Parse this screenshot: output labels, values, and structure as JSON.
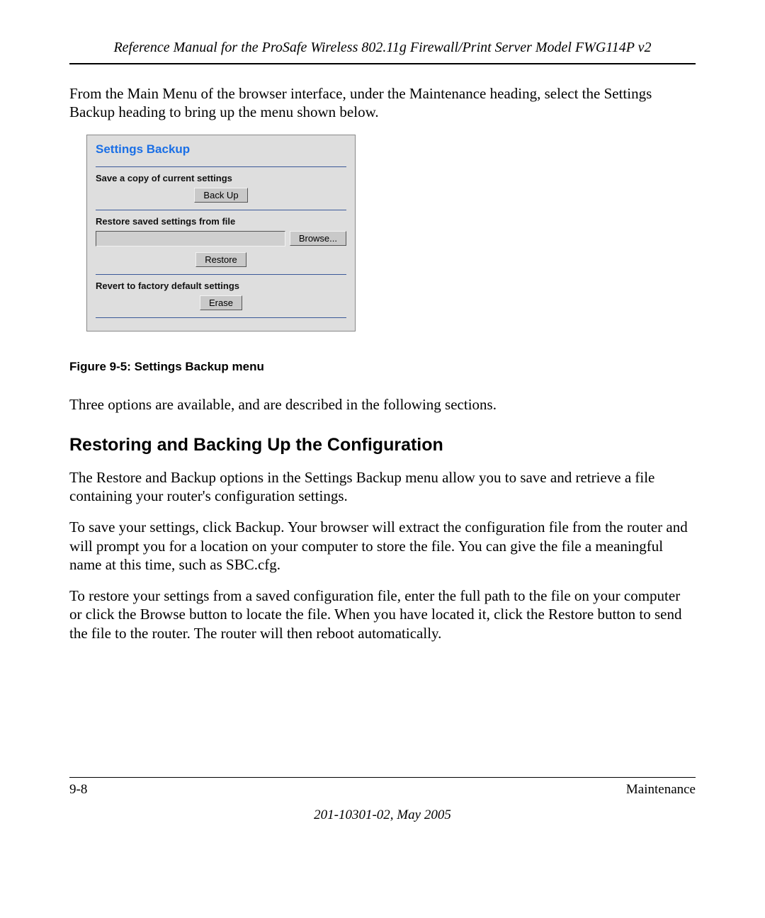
{
  "header": {
    "title": "Reference Manual for the ProSafe Wireless 802.11g  Firewall/Print Server Model FWG114P v2"
  },
  "intro_para": "From the Main Menu of the browser interface, under the Maintenance heading, select the Settings Backup heading to bring up the menu shown below.",
  "screenshot": {
    "title": "Settings Backup",
    "save_label": "Save a copy of current settings",
    "backup_button": "Back Up",
    "restore_label": "Restore saved settings from file",
    "browse_button": "Browse...",
    "restore_button": "Restore",
    "revert_label": "Revert to factory default settings",
    "erase_button": "Erase"
  },
  "figure_caption": "Figure 9-5:  Settings Backup menu",
  "para_after_figure": "Three options are available, and are described in the following sections.",
  "section_heading": "Restoring and Backing Up the Configuration",
  "para_1": "The Restore and Backup options in the Settings Backup menu allow you to save and retrieve a file containing your router's configuration settings.",
  "para_2": "To save your settings, click Backup. Your browser will extract the configuration file from the router and will prompt you for a location on your computer to store the file. You can give the file a meaningful name at this time, such as SBC.cfg.",
  "para_3": "To restore your settings from a saved configuration file, enter the full path to the file on your computer or click the Browse button to locate the file. When you have located it, click the Restore button to send the file to the router. The router will then reboot automatically.",
  "footer": {
    "page": "9-8",
    "section": "Maintenance",
    "docinfo": "201-10301-02, May 2005"
  }
}
